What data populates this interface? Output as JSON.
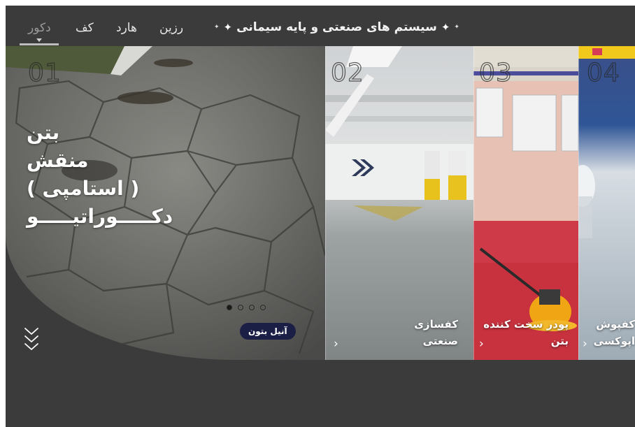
{
  "nav": {
    "items": [
      {
        "label": "دکور",
        "active": true
      },
      {
        "label": "کف",
        "active": false
      },
      {
        "label": "هارد",
        "active": false
      },
      {
        "label": "رزین",
        "active": false
      }
    ],
    "brand": "سیستم های صنعتی و پایه سیمانی"
  },
  "panels": [
    {
      "number": "01",
      "headline_lines": [
        "بتن",
        "منقش",
        "( استامپی )",
        "دکـــــوراتیـــــو"
      ],
      "slide_count": 4,
      "active_slide": 1,
      "tag": "آنیل بتون",
      "image": "stamped-concrete-photo"
    },
    {
      "number": "02",
      "caption_lines": [
        "کفسازی",
        "صنعتی"
      ],
      "image": "parking-garage-photo"
    },
    {
      "number": "03",
      "caption_lines": [
        "پودر سخت کننده",
        "بتن"
      ],
      "image": "red-floor-trowel-photo"
    },
    {
      "number": "04",
      "caption_lines": [
        "کفپوش",
        "اپوکسی"
      ],
      "image": "epoxy-floor-photo"
    }
  ],
  "icons": {
    "scroll": "chevrons-down-icon",
    "arrow": "chevron-right-icon",
    "sparkle": "sparkle-icon"
  },
  "colors": {
    "background": "#3b3b3b",
    "pill": "#1c1f45",
    "red_floor": "#c8323f"
  }
}
